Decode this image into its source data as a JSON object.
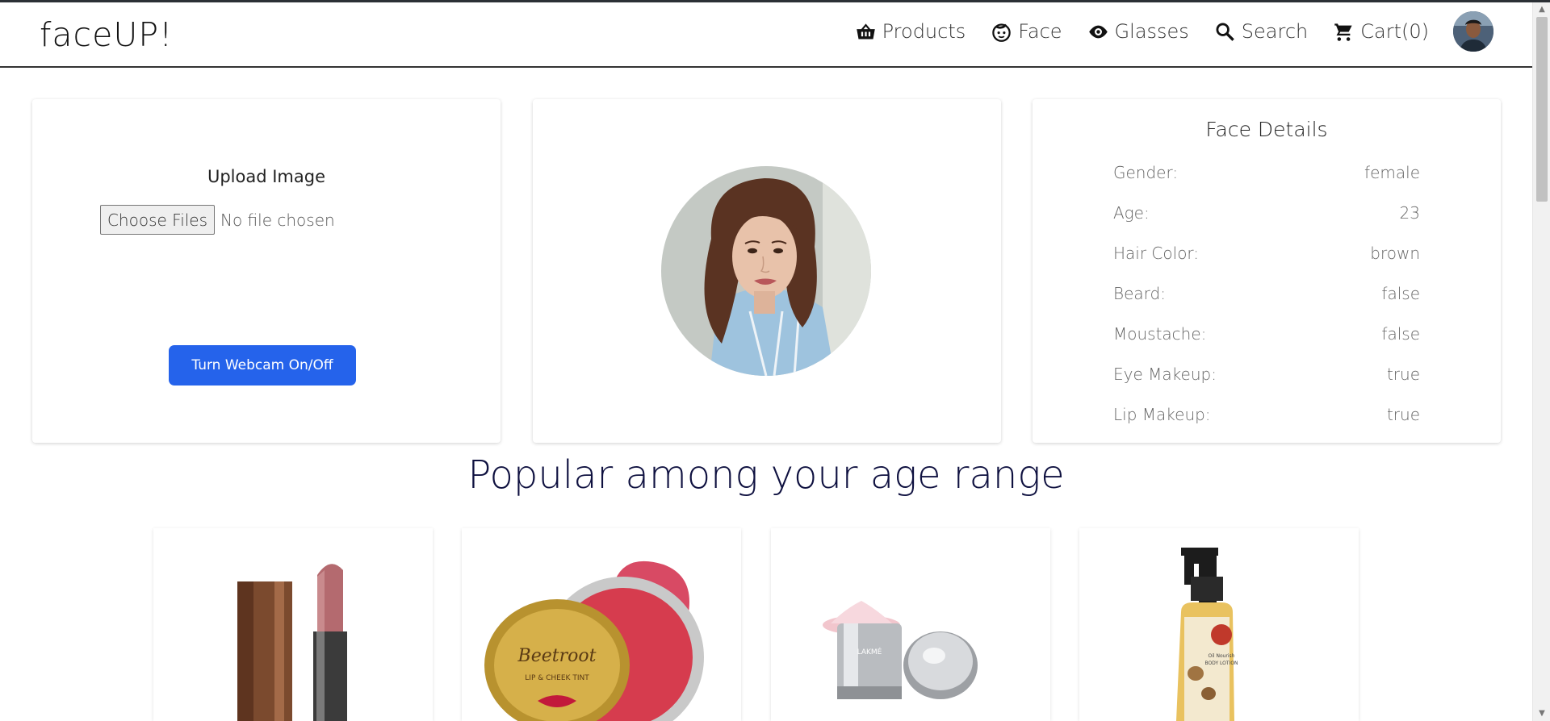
{
  "app": {
    "brand": "faceUP!"
  },
  "nav": {
    "items": [
      {
        "label": "Products",
        "icon": "basket-icon"
      },
      {
        "label": "Face",
        "icon": "face-icon"
      },
      {
        "label": "Glasses",
        "icon": "eye-icon"
      },
      {
        "label": "Search",
        "icon": "search-icon"
      },
      {
        "label": "Cart(0)",
        "icon": "cart-icon"
      }
    ],
    "avatar": "avatar"
  },
  "upload": {
    "title": "Upload Image",
    "file_button": "Choose Files",
    "file_status": "No file chosen",
    "webcam_button": "Turn Webcam On/Off"
  },
  "details": {
    "title": "Face Details",
    "rows": [
      {
        "label": "Gender:",
        "value": "female"
      },
      {
        "label": "Age:",
        "value": "23"
      },
      {
        "label": "Hair Color:",
        "value": "brown"
      },
      {
        "label": "Beard:",
        "value": "false"
      },
      {
        "label": "Moustache:",
        "value": "false"
      },
      {
        "label": "Eye Makeup:",
        "value": "true"
      },
      {
        "label": "Lip Makeup:",
        "value": "true"
      }
    ]
  },
  "popular": {
    "title": "Popular among your age range",
    "products": [
      {
        "name": "lipstick"
      },
      {
        "name": "lip-and-cheek-tint"
      },
      {
        "name": "face-cream"
      },
      {
        "name": "body-lotion"
      }
    ],
    "tint_label_1": "Beetroot",
    "tint_label_2": "LIP & CHEEK TINT",
    "cream_label": "LAKMÉ",
    "lotion_label_1": "Oil Nourish",
    "lotion_label_2": "BODY LOTION"
  },
  "colors": {
    "accent_button": "#2563eb",
    "heading": "#0f1140",
    "navbar_border": "#333333"
  }
}
